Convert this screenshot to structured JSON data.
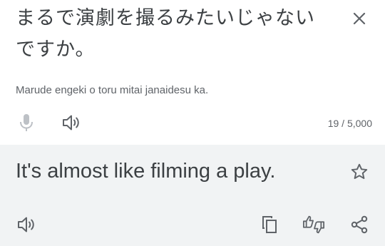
{
  "source": {
    "text": "まるで演劇を撮るみたいじゃないですか。",
    "romanization": "Marude engeki o toru mitai janaidesu ka.",
    "char_count": "19 / 5,000",
    "icons": {
      "close": "close-icon",
      "mic": "mic-icon",
      "speaker": "speaker-icon"
    }
  },
  "target": {
    "text": "It's almost like filming a play.",
    "icons": {
      "star": "star-icon",
      "speaker": "speaker-icon",
      "copy": "copy-icon",
      "feedback": "thumbs-up-down-icon",
      "share": "share-icon"
    }
  },
  "colors": {
    "text_primary": "#3c4043",
    "text_secondary": "#5f6368",
    "icon": "#5f6368",
    "icon_disabled": "#bdc1c6",
    "target_background": "#f1f3f4"
  }
}
